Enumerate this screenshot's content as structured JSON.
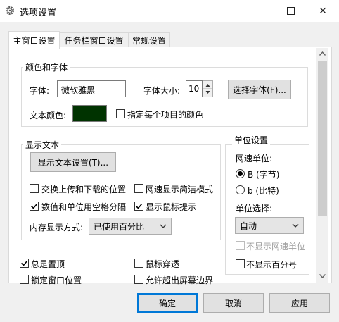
{
  "window": {
    "title": "选项设置",
    "close_glyph": "✕"
  },
  "tabs": [
    {
      "label": "主窗口设置",
      "active": true
    },
    {
      "label": "任务栏窗口设置",
      "active": false
    },
    {
      "label": "常规设置",
      "active": false
    }
  ],
  "color_font": {
    "group_title": "颜色和字体",
    "font_label": "字体:",
    "font_value": "微软雅黑",
    "font_size_label": "字体大小:",
    "font_size_value": "10",
    "select_font_button": "选择字体(F)...",
    "text_color_label": "文本颜色:",
    "text_color": "#003300",
    "per_item_color_label": "指定每个项目的颜色",
    "per_item_color_checked": false
  },
  "display_text": {
    "group_title": "显示文本",
    "settings_button": "显示文本设置(T)...",
    "swap_updown_label": "交换上传和下载的位置",
    "swap_updown_checked": false,
    "speed_simple_label": "网速显示简洁模式",
    "speed_simple_checked": false,
    "space_sep_label": "数值和单位用空格分隔",
    "space_sep_checked": true,
    "mouse_tip_label": "显示鼠标提示",
    "mouse_tip_checked": true,
    "memory_mode_label": "内存显示方式:",
    "memory_mode_value": "已使用百分比"
  },
  "units": {
    "group_title": "单位设置",
    "speed_unit_label": "网速单位:",
    "byte_label": "B (字节)",
    "bit_label": "b (比特)",
    "selected_unit": "B",
    "unit_select_label": "单位选择:",
    "unit_select_value": "自动",
    "hide_speed_unit_label": "不显示网速单位",
    "hide_speed_unit_checked": false,
    "hide_percent_label": "不显示百分号",
    "hide_percent_checked": false
  },
  "general": {
    "always_top_label": "总是置顶",
    "always_top_checked": true,
    "mouse_through_label": "鼠标穿透",
    "mouse_through_checked": false,
    "lock_pos_label": "锁定窗口位置",
    "lock_pos_checked": false,
    "allow_offscreen_label": "允许超出屏幕边界",
    "allow_offscreen_checked": false
  },
  "footer": {
    "ok": "确定",
    "cancel": "取消",
    "apply": "应用"
  }
}
